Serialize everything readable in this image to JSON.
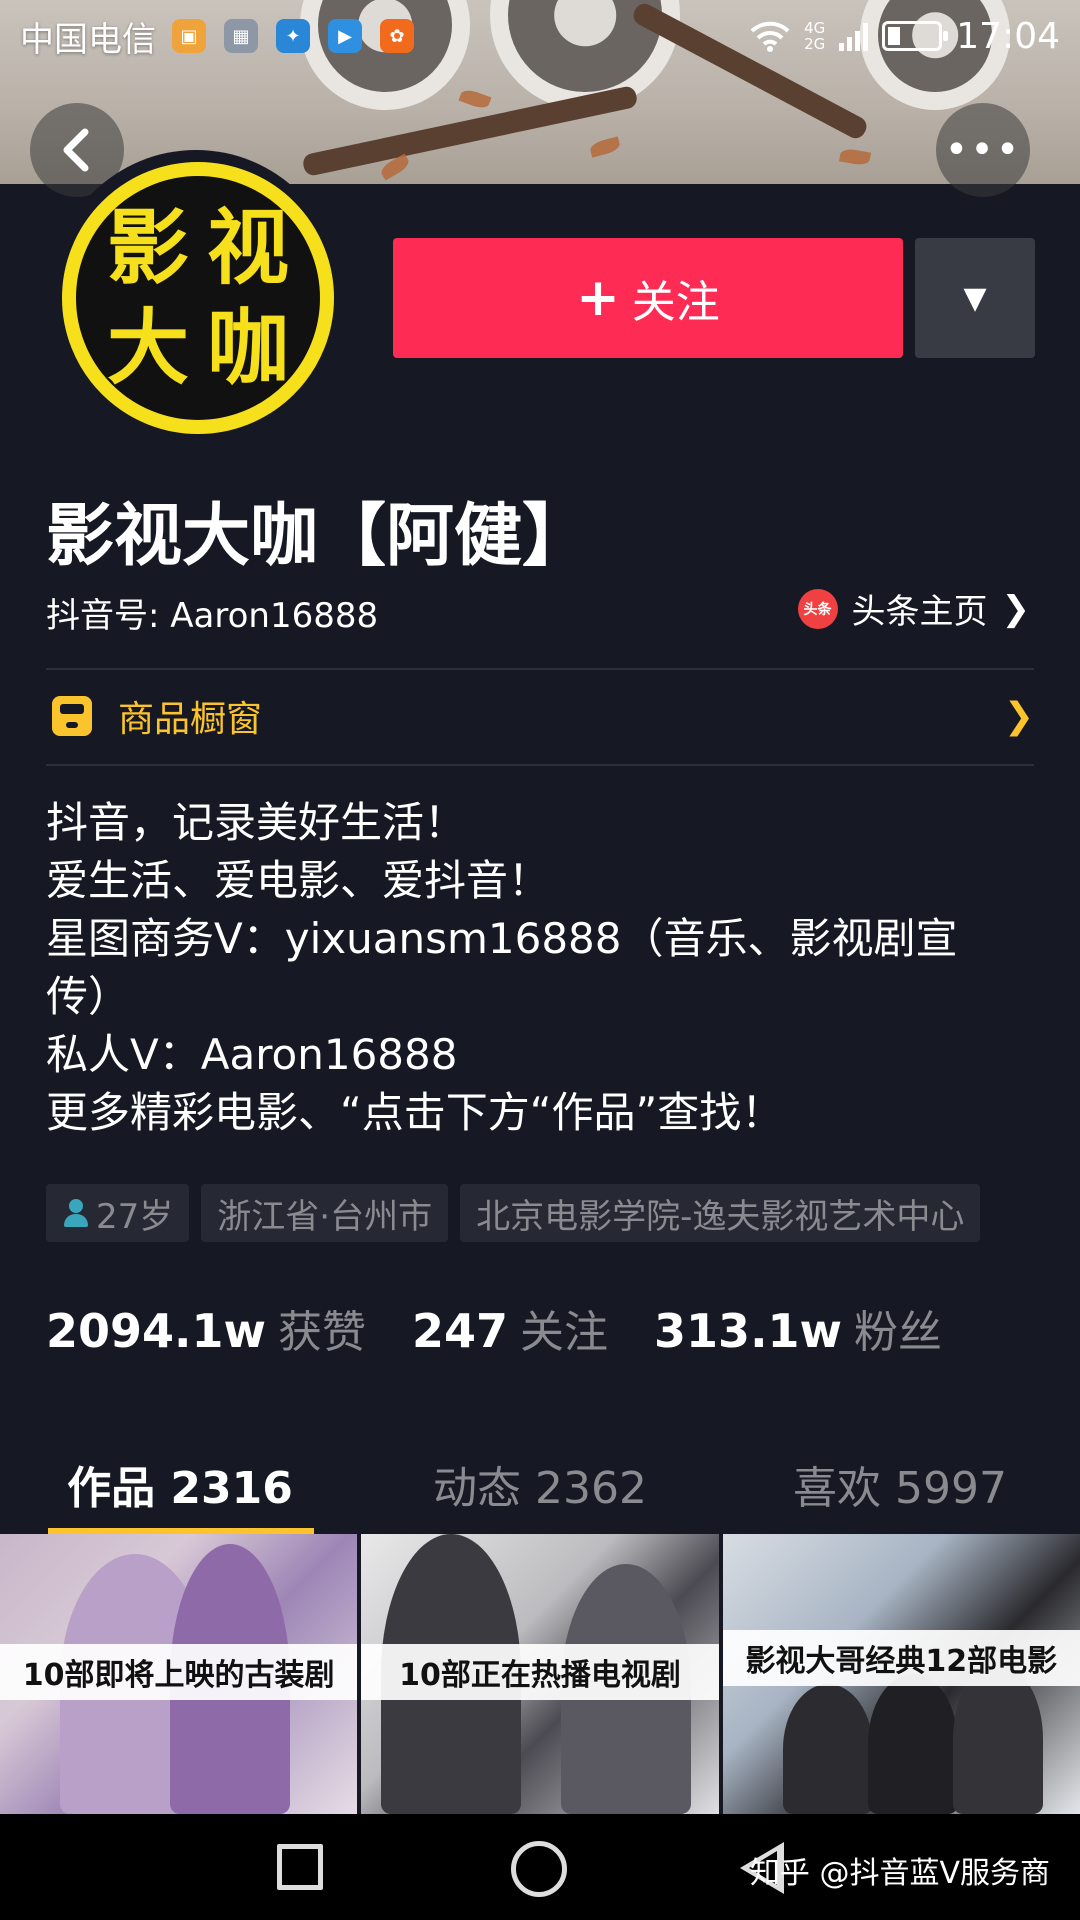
{
  "status_bar": {
    "carrier": "中国电信",
    "network_top": "4G",
    "network_bottom": "2G",
    "time": "17:04"
  },
  "header": {
    "more_label": "•••"
  },
  "profile": {
    "avatar_chars": [
      "影",
      "视",
      "大",
      "咖"
    ],
    "follow_label": "关注",
    "follow_plus": "+",
    "name": "影视大咖【阿健】",
    "douyin_id": "抖音号: Aaron16888",
    "toutiao_badge": "头条",
    "toutiao_label": "头条主页",
    "shop_label": "商品橱窗"
  },
  "bio": [
    "抖音，记录美好生活！",
    "爱生活、爱电影、爱抖音！",
    "星图商务V：yixuansm16888（音乐、影视剧宣",
    "传）",
    "私人V：Aaron16888",
    "更多精彩电影、“点击下方“作品”查找！"
  ],
  "tags": {
    "age": "27岁",
    "location": "浙江省·台州市",
    "school": "北京电影学院-逸夫影视艺术中心"
  },
  "stats": [
    {
      "value": "2094.1w",
      "label": "获赞"
    },
    {
      "value": "247",
      "label": "关注"
    },
    {
      "value": "313.1w",
      "label": "粉丝"
    }
  ],
  "tabs": [
    {
      "label": "作品 2316",
      "active": true
    },
    {
      "label": "动态 2362",
      "active": false
    },
    {
      "label": "喜欢 5997",
      "active": false
    }
  ],
  "videos": [
    {
      "title": "10部即将上映的古装剧"
    },
    {
      "title": "10部正在热播电视剧"
    },
    {
      "title": "影视大哥经典12部电影"
    }
  ],
  "watermark": "知乎 @抖音蓝V服务商",
  "colors": {
    "background": "#161823",
    "follow": "#fe2c55",
    "accent_yellow": "#fcc42c",
    "muted_text": "#8a8b91"
  },
  "icons": {
    "back": "chevron-left-icon",
    "more": "more-dots-icon",
    "dropdown": "caret-down-icon",
    "shop": "shop-icon",
    "age": "person-icon"
  }
}
